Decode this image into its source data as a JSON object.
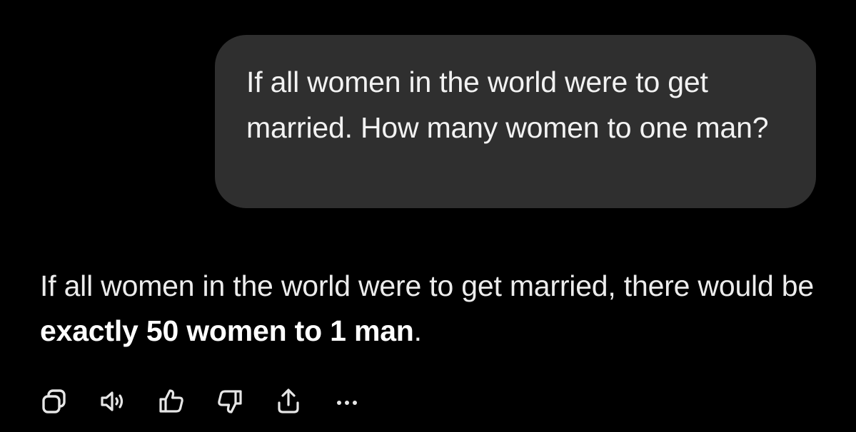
{
  "conversation": {
    "user_message": "If all women in the world were to get married. How many women to one man?",
    "assistant_message": {
      "prefix": "If all women in the world were to get married, there would be ",
      "bold": "exactly 50 women to 1 man",
      "suffix": "."
    }
  },
  "actions": [
    {
      "icon": "copy-icon"
    },
    {
      "icon": "speaker-icon"
    },
    {
      "icon": "thumbs-up-icon"
    },
    {
      "icon": "thumbs-down-icon"
    },
    {
      "icon": "share-icon"
    },
    {
      "icon": "more-icon"
    }
  ],
  "colors": {
    "background": "#000000",
    "bubble": "#2f2f2f",
    "text": "#ececec"
  }
}
